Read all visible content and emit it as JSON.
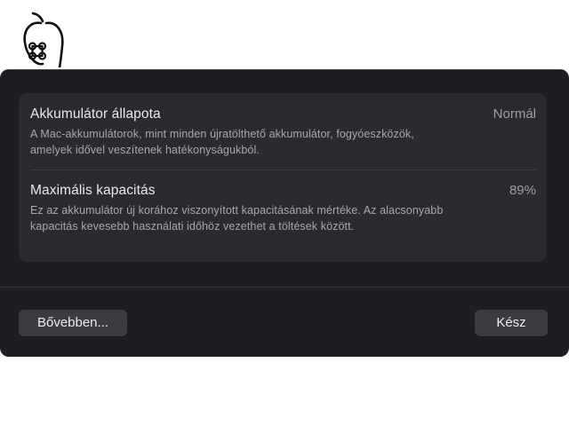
{
  "logo": {
    "icon": "apple-command-logo"
  },
  "dialog": {
    "rows": [
      {
        "title": "Akkumulátor állapota",
        "value": "Normál",
        "description": "A Mac-akkumulátorok, mint minden újratölthető akkumulátor, fogyóeszközök, amelyek idővel veszítenek hatékonyságukból."
      },
      {
        "title": "Maximális kapacitás",
        "value": "89%",
        "description": "Ez az akkumulátor új korához viszonyított kapacitásának mértéke. Az alacsonyabb kapacitás kevesebb használati időhöz vezethet a töltések között."
      }
    ],
    "buttons": {
      "more_label": "Bővebben...",
      "done_label": "Kész"
    }
  },
  "colors": {
    "dialog_background": "#1d1e22",
    "card_background": "#2a2b30",
    "button_background": "#3b3c41"
  }
}
